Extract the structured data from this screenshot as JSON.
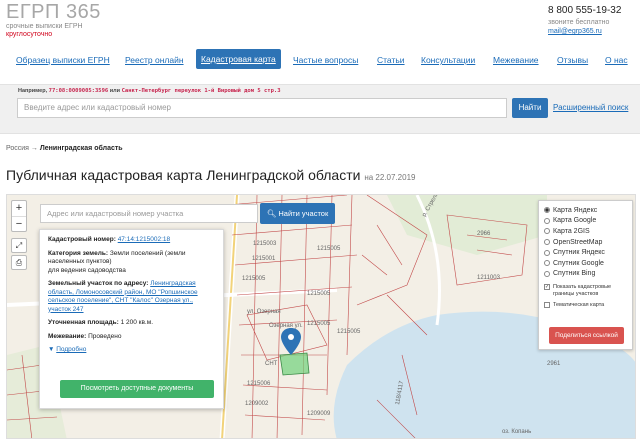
{
  "header": {
    "logo_title": "ЕГРП 365",
    "logo_sub1": "срочные выписки ЕГРН",
    "logo_sub2": "круглосуточно",
    "phone": "8 800 555-19-32",
    "phone_note": "звоните бесплатно",
    "email": "mail@egrp365.ru"
  },
  "nav": {
    "items": [
      {
        "label": "Образец выписки ЕГРН",
        "active": false
      },
      {
        "label": "Реестр онлайн",
        "active": false
      },
      {
        "label": "Кадастровая карта",
        "active": true
      },
      {
        "label": "Частые вопросы",
        "active": false
      },
      {
        "label": "Статьи",
        "active": false
      },
      {
        "label": "Консультации",
        "active": false
      },
      {
        "label": "Межевание",
        "active": false
      },
      {
        "label": "Отзывы",
        "active": false
      },
      {
        "label": "О нас",
        "active": false
      }
    ]
  },
  "search": {
    "example_prefix": "Например,",
    "example_code": "77:08:0009005:3596",
    "example_or": "или",
    "example_address": "Санкт-Петербург переулок 1-й Вировый дом 5 стр.3",
    "placeholder": "Введите адрес или кадастровый номер",
    "button": "Найти",
    "advanced": "Расширенный поиск"
  },
  "breadcrumb": {
    "root": "Россия",
    "arrow": "→",
    "current": "Ленинградская область"
  },
  "page": {
    "title": "Публичная кадастровая карта Ленинградской области",
    "date": "на 22.07.2019"
  },
  "map": {
    "zoom_in": "+",
    "zoom_out": "−",
    "fullscreen": "⤢",
    "print": "⎙",
    "ruler": "≡",
    "search_placeholder": "Адрес или кадастровый номер участка",
    "search_button": "Найти участок",
    "labels": [
      "1215005",
      "1215003",
      "1215005",
      "1215005",
      "1215005",
      "1209009",
      "1215006",
      "1209002",
      "1215005",
      "2966",
      "1211003",
      "2961",
      "ул. Озерная",
      "оз. Копань",
      "р. Стрелка",
      "Озерная ул.",
      "СНТ",
      "1215005",
      "1215001",
      "118/4117"
    ]
  },
  "info": {
    "cadastral_label": "Кадастровый номер:",
    "cadastral_value": "47:14:1215002:18",
    "category_label": "Категория земель:",
    "category_value": "Земли поселений (земли населенных пунктов)",
    "category_sub": "для ведения садоводства",
    "address_label": "Земельный участок по адресу:",
    "address_value": "Ленинградская область, Ломоносовский район, МО \"Ропшинское сельское поселение\", СНТ \"Калос\" Озерная ул., участок 247",
    "area_label": "Уточненная площадь:",
    "area_value": "1 200 кв.м.",
    "survey_label": "Межевание:",
    "survey_value": "Проведено",
    "more": "Подробно",
    "docs_button": "Посмотреть доступные документы"
  },
  "layers": {
    "options": [
      {
        "label": "Карта Яндекс",
        "selected": true
      },
      {
        "label": "Карта Google",
        "selected": false
      },
      {
        "label": "Карта 2GIS",
        "selected": false
      },
      {
        "label": "OpenStreetMap",
        "selected": false
      },
      {
        "label": "Спутник Яндекс",
        "selected": false
      },
      {
        "label": "Спутник Google",
        "selected": false
      },
      {
        "label": "Спутник Bing",
        "selected": false
      }
    ],
    "check_cadastral": "Показать кадастровые границы участков",
    "check_cadastral_on": true,
    "check_thematic": "Тематическая карта",
    "check_thematic_on": false,
    "share_button": "Поделиться ссылкой"
  },
  "colors": {
    "accent": "#2d73b5",
    "link": "#1a6bb8",
    "green_button": "#41b36a",
    "red_button": "#d9534f",
    "lake": "#cfe3ef",
    "parcel_border": "#c24a4a"
  }
}
